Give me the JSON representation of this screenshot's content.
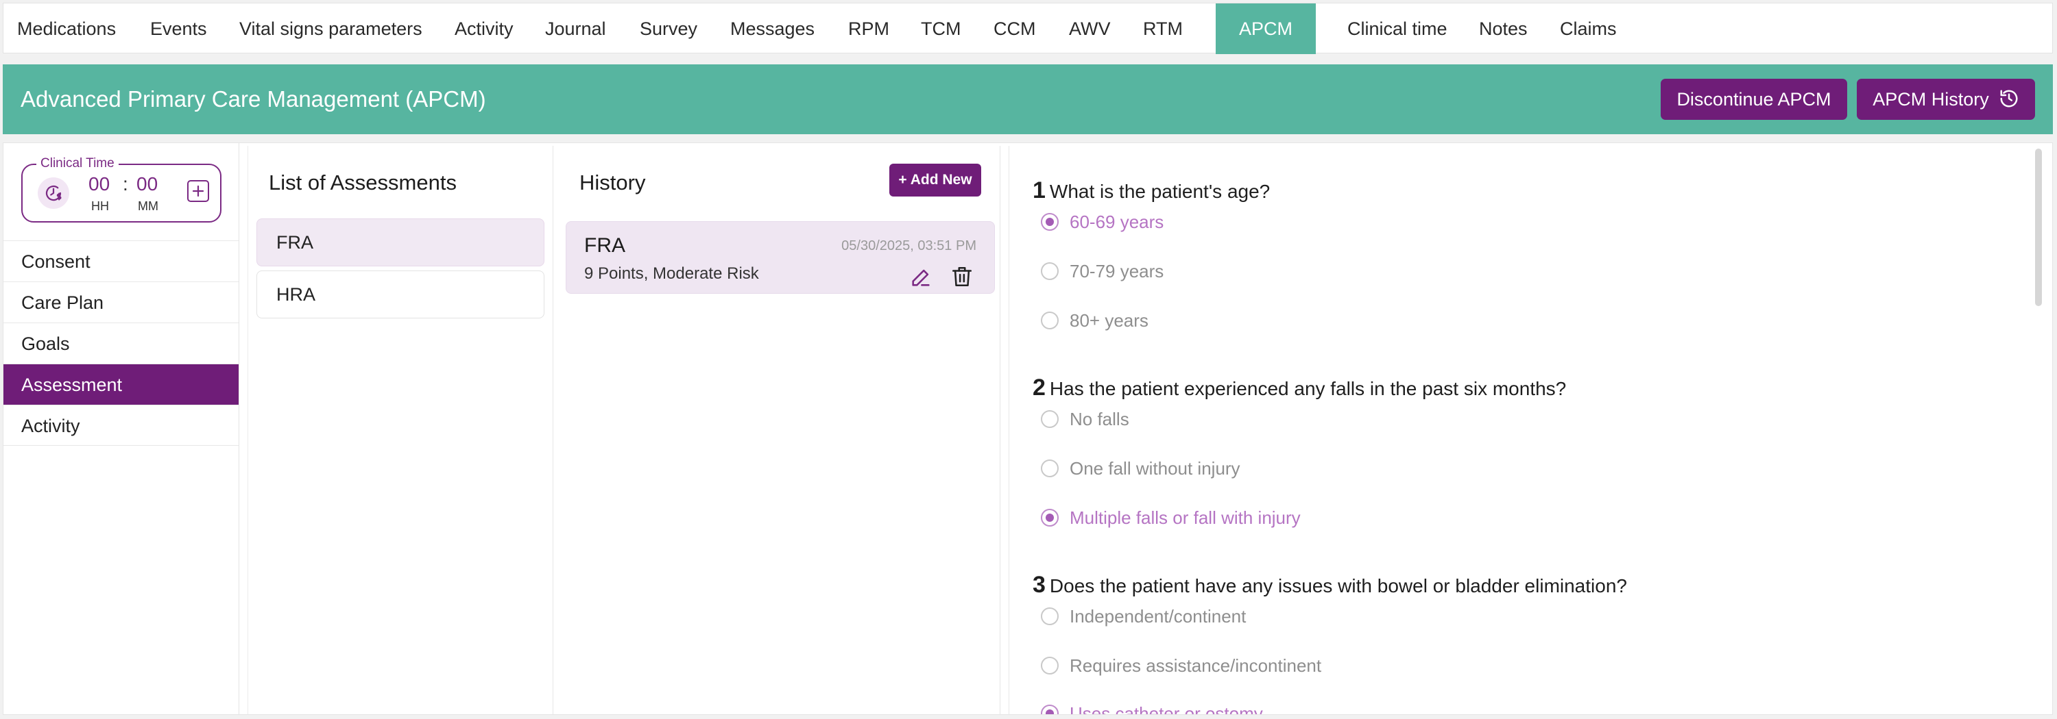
{
  "nav": {
    "tabs": [
      {
        "label": "Medications"
      },
      {
        "label": "Events"
      },
      {
        "label": "Vital signs parameters"
      },
      {
        "label": "Activity"
      },
      {
        "label": "Journal"
      },
      {
        "label": "Survey"
      },
      {
        "label": "Messages"
      },
      {
        "label": "RPM"
      },
      {
        "label": "TCM"
      },
      {
        "label": "CCM"
      },
      {
        "label": "AWV"
      },
      {
        "label": "RTM"
      },
      {
        "label": "APCM"
      },
      {
        "label": "Clinical time"
      },
      {
        "label": "Notes"
      },
      {
        "label": "Claims"
      }
    ],
    "active": "APCM"
  },
  "header": {
    "title": "Advanced Primary Care Management (APCM)",
    "discontinue_label": "Discontinue APCM",
    "history_label": "APCM History"
  },
  "clinical_time": {
    "legend": "Clinical Time",
    "hours": "00",
    "minutes": "00",
    "hours_unit": "HH",
    "minutes_unit": "MM",
    "separator": ":"
  },
  "sidebar": {
    "items": [
      {
        "label": "Consent"
      },
      {
        "label": "Care Plan"
      },
      {
        "label": "Goals"
      },
      {
        "label": "Assessment"
      },
      {
        "label": "Activity"
      }
    ],
    "active": "Assessment"
  },
  "assessments": {
    "title": "List of Assessments",
    "items": [
      {
        "label": "FRA"
      },
      {
        "label": "HRA"
      }
    ],
    "selected": "FRA"
  },
  "history": {
    "title": "History",
    "add_label": "+ Add New",
    "entries": [
      {
        "name": "FRA",
        "date": "05/30/2025, 03:51 PM",
        "summary": "9 Points, Moderate Risk"
      }
    ]
  },
  "questions": [
    {
      "number": "1",
      "text": "What is the patient's age?",
      "options": [
        {
          "label": "60-69 years",
          "selected": true
        },
        {
          "label": "70-79 years",
          "selected": false
        },
        {
          "label": "80+ years",
          "selected": false
        }
      ]
    },
    {
      "number": "2",
      "text": "Has the patient experienced any falls in the past six months?",
      "options": [
        {
          "label": "No falls",
          "selected": false
        },
        {
          "label": "One fall without injury",
          "selected": false
        },
        {
          "label": "Multiple falls or fall with injury",
          "selected": true
        }
      ]
    },
    {
      "number": "3",
      "text": "Does the patient have any issues with bowel or bladder elimination?",
      "options": [
        {
          "label": "Independent/continent",
          "selected": false
        },
        {
          "label": "Requires assistance/incontinent",
          "selected": false
        },
        {
          "label": "Uses catheter or ostomy",
          "selected": true
        }
      ]
    }
  ],
  "colors": {
    "teal": "#57b5a0",
    "purple": "#6f1d78",
    "selected_option": "#b574c3"
  }
}
